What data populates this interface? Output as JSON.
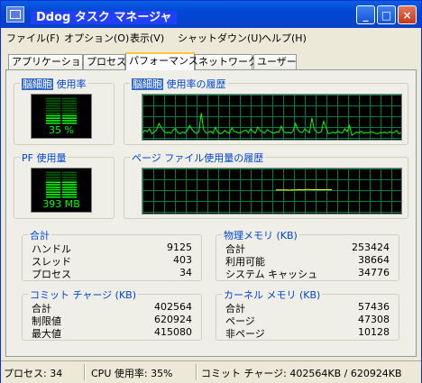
{
  "window": {
    "title": "Ddog タスク マネージャ",
    "buttons": {
      "minimize": "_",
      "maximize": "□",
      "close": "×"
    }
  },
  "menu": [
    "ファイル(F)",
    "オプション(O)",
    "表示(V)",
    "シャットダウン(U)",
    "ヘルプ(H)"
  ],
  "tabs": [
    "アプリケーション",
    "プロセス",
    "パフォーマンス",
    "ネットワーク",
    "ユーザー"
  ],
  "active_tab": "パフォーマンス",
  "cpu": {
    "label_hl": "脳細胞",
    "label": "使用率",
    "value": "35 %",
    "percent": 35,
    "history_label_hl": "脳細胞",
    "history_label": "使用率の履歴",
    "history_values": [
      12,
      18,
      15,
      22,
      10,
      14,
      20,
      35,
      25,
      16,
      12,
      14,
      11,
      19,
      23,
      13,
      10,
      14,
      12,
      18,
      30,
      21,
      14,
      11,
      15,
      60,
      20,
      12,
      13,
      16,
      11,
      25,
      14,
      10,
      12,
      18,
      13,
      11,
      24,
      15,
      14,
      12,
      13,
      17,
      19,
      12,
      22,
      15,
      11,
      26,
      18,
      14,
      12,
      20,
      16,
      13,
      11,
      15,
      13,
      28,
      15,
      12,
      14,
      11,
      16,
      35,
      20,
      14,
      13,
      22,
      17,
      12,
      48,
      20,
      14,
      12,
      15,
      40,
      25,
      10,
      12,
      14,
      11,
      16,
      13,
      12,
      22,
      15,
      30,
      6,
      10,
      14,
      12,
      16,
      11,
      13,
      12,
      15,
      14,
      11,
      10,
      13,
      12,
      14,
      11,
      15,
      12,
      13,
      18,
      10,
      12
    ]
  },
  "pf": {
    "label": "PF 使用量",
    "value": "393 MB",
    "percent": 63,
    "history_label": "ページ ファイル使用量の履歴",
    "history_values": [
      62,
      62,
      62,
      62,
      62,
      62,
      61,
      62,
      62,
      62,
      63,
      63,
      62,
      63,
      64,
      64,
      63,
      63,
      63,
      63,
      63,
      63,
      63,
      63,
      63,
      63
    ]
  },
  "totals": {
    "title": "合計",
    "rows": [
      {
        "label": "ハンドル",
        "value": "9125"
      },
      {
        "label": "スレッド",
        "value": "403"
      },
      {
        "label": "プロセス",
        "value": "34"
      }
    ]
  },
  "physical_memory": {
    "title": "物理メモリ (KB)",
    "rows": [
      {
        "label": "合計",
        "value": "253424"
      },
      {
        "label": "利用可能",
        "value": "38664"
      },
      {
        "label": "システム キャッシュ",
        "value": "34776"
      }
    ]
  },
  "commit_charge": {
    "title": "コミット チャージ (KB)",
    "rows": [
      {
        "label": "合計",
        "value": "402564"
      },
      {
        "label": "制限値",
        "value": "620924"
      },
      {
        "label": "最大値",
        "value": "415080"
      }
    ]
  },
  "kernel_memory": {
    "title": "カーネル メモリ (KB)",
    "rows": [
      {
        "label": "合計",
        "value": "57436"
      },
      {
        "label": "ページ",
        "value": "47308"
      },
      {
        "label": "非ページ",
        "value": "10128"
      }
    ]
  },
  "status": {
    "processes": "プロセス: 34",
    "cpu": "CPU 使用率: 35%",
    "commit": "コミット チャージ: 402564KB / 620924KB"
  },
  "colors": {
    "graph_line": "#00ff00",
    "grid": "#008040",
    "pf_line": "#ffff00",
    "accent": "#0046d5"
  }
}
